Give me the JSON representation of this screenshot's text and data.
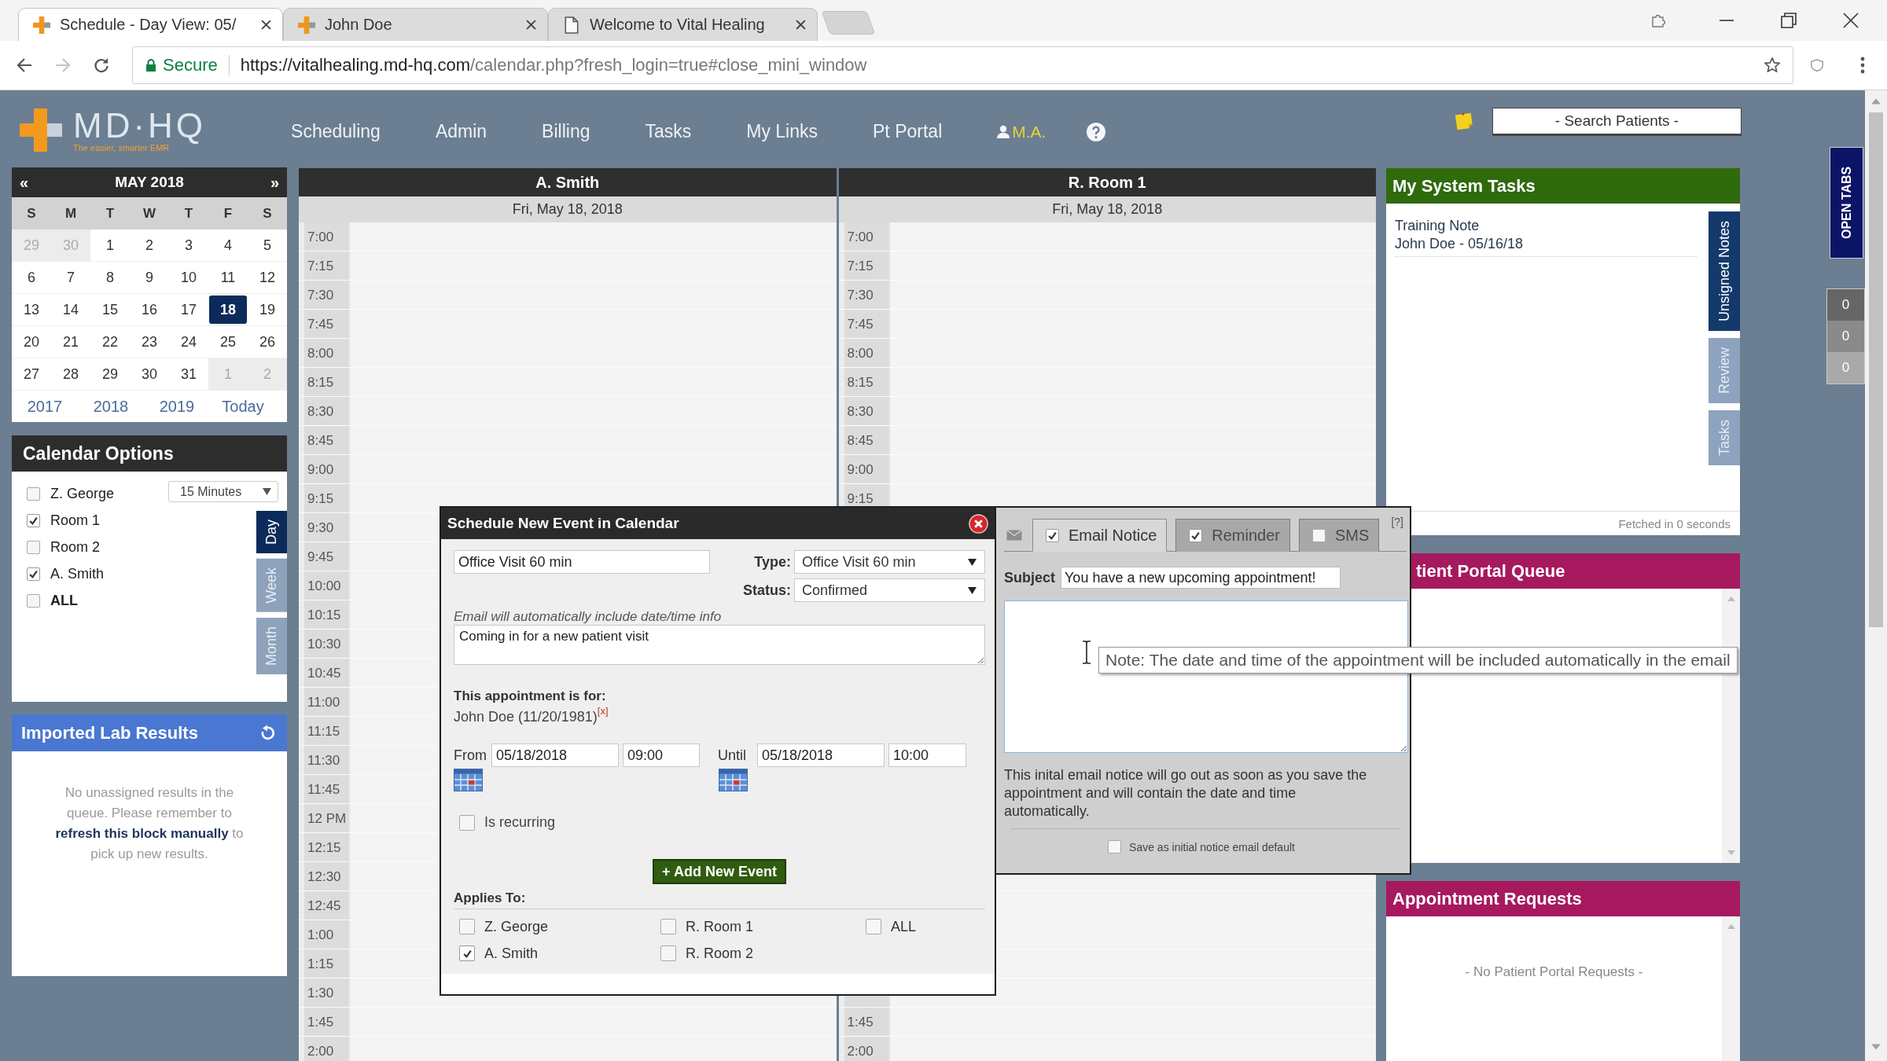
{
  "browser": {
    "tabs": [
      {
        "kind": "app",
        "title": "Schedule - Day View: 05/",
        "selected": true
      },
      {
        "kind": "app",
        "title": "John Doe",
        "selected": false
      },
      {
        "kind": "page",
        "title": "Welcome to Vital Healing",
        "selected": false
      }
    ],
    "secure_label": "Secure",
    "url_host": "https://vitalhealing.md-hq.com",
    "url_path": "/calendar.php?fresh_login=true#close_mini_window"
  },
  "header": {
    "logo": "MD·HQ",
    "tagline": "The easier, smarter EMR",
    "nav": [
      "Scheduling",
      "Admin",
      "Billing",
      "Tasks",
      "My Links",
      "Pt Portal"
    ],
    "user": "M.A.",
    "search_placeholder": "- Search Patients -"
  },
  "mini_calendar": {
    "prev": "«",
    "month": "MAY 2018",
    "next": "»",
    "weekdays": [
      "S",
      "M",
      "T",
      "W",
      "T",
      "F",
      "S"
    ],
    "weeks": [
      [
        {
          "day": "29",
          "other_month": true,
          "selected": false
        },
        {
          "day": "30",
          "other_month": true,
          "selected": false
        },
        {
          "day": "1",
          "other_month": false,
          "selected": false
        },
        {
          "day": "2",
          "other_month": false,
          "selected": false
        },
        {
          "day": "3",
          "other_month": false,
          "selected": false
        },
        {
          "day": "4",
          "other_month": false,
          "selected": false
        },
        {
          "day": "5",
          "other_month": false,
          "selected": false
        }
      ],
      [
        {
          "day": "6",
          "other_month": false,
          "selected": false
        },
        {
          "day": "7",
          "other_month": false,
          "selected": false
        },
        {
          "day": "8",
          "other_month": false,
          "selected": false
        },
        {
          "day": "9",
          "other_month": false,
          "selected": false
        },
        {
          "day": "10",
          "other_month": false,
          "selected": false
        },
        {
          "day": "11",
          "other_month": false,
          "selected": false
        },
        {
          "day": "12",
          "other_month": false,
          "selected": false
        }
      ],
      [
        {
          "day": "13",
          "other_month": false,
          "selected": false
        },
        {
          "day": "14",
          "other_month": false,
          "selected": false
        },
        {
          "day": "15",
          "other_month": false,
          "selected": false
        },
        {
          "day": "16",
          "other_month": false,
          "selected": false
        },
        {
          "day": "17",
          "other_month": false,
          "selected": false
        },
        {
          "day": "18",
          "other_month": false,
          "selected": true
        },
        {
          "day": "19",
          "other_month": false,
          "selected": false
        }
      ],
      [
        {
          "day": "20",
          "other_month": false,
          "selected": false
        },
        {
          "day": "21",
          "other_month": false,
          "selected": false
        },
        {
          "day": "22",
          "other_month": false,
          "selected": false
        },
        {
          "day": "23",
          "other_month": false,
          "selected": false
        },
        {
          "day": "24",
          "other_month": false,
          "selected": false
        },
        {
          "day": "25",
          "other_month": false,
          "selected": false
        },
        {
          "day": "26",
          "other_month": false,
          "selected": false
        }
      ],
      [
        {
          "day": "27",
          "other_month": false,
          "selected": false
        },
        {
          "day": "28",
          "other_month": false,
          "selected": false
        },
        {
          "day": "29",
          "other_month": false,
          "selected": false
        },
        {
          "day": "30",
          "other_month": false,
          "selected": false
        },
        {
          "day": "31",
          "other_month": false,
          "selected": false
        },
        {
          "day": "1",
          "other_month": true,
          "selected": false
        },
        {
          "day": "2",
          "other_month": true,
          "selected": false
        }
      ]
    ],
    "years": [
      "2017",
      "2018",
      "2019"
    ],
    "today": "Today"
  },
  "calendar_options": {
    "title": "Calendar Options",
    "resources": [
      {
        "kind": "resource",
        "label": "Z. George",
        "checked": false
      },
      {
        "kind": "resource",
        "label": "Room 1",
        "checked": true
      },
      {
        "kind": "resource",
        "label": "Room 2",
        "checked": false
      },
      {
        "kind": "resource",
        "label": "A. Smith",
        "checked": true
      },
      {
        "kind": "all",
        "label": "ALL",
        "checked": false
      }
    ],
    "interval": "15 Minutes",
    "views": [
      {
        "label": "Day",
        "selected": true
      },
      {
        "label": "Week",
        "selected": false
      },
      {
        "label": "Month",
        "selected": false
      }
    ]
  },
  "lab_results": {
    "title": "Imported Lab Results",
    "message_start": "No unassigned results in the queue. Please remember to",
    "refresh_link": "refresh this block manually",
    "message_end": "to pick up new results."
  },
  "calendar": {
    "columns": [
      {
        "name": "A. Smith",
        "date": "Fri, May 18, 2018",
        "times": [
          "7:00",
          "7:15",
          "7:30",
          "7:45",
          "8:00",
          "8:15",
          "8:30",
          "8:45",
          "9:00",
          "9:15",
          "9:30",
          "9:45",
          "10:00",
          "10:15",
          "10:30",
          "10:45",
          "11:00",
          "11:15",
          "11:30",
          "11:45",
          "12 PM",
          "12:15",
          "12:30",
          "12:45",
          "1:00",
          "1:15",
          "1:30",
          "1:45",
          "2:00"
        ]
      },
      {
        "name": "R. Room 1",
        "date": "Fri, May 18, 2018",
        "times": [
          "7:00",
          "7:15",
          "7:30",
          "7:45",
          "8:00",
          "8:15",
          "8:30",
          "8:45",
          "9:00",
          "9:15"
        ],
        "times_end": [
          "1:45",
          "2:00"
        ]
      }
    ]
  },
  "dialog": {
    "title": "Schedule New Event in Calendar",
    "name_value": "Office Visit 60 min",
    "type_label": "Type:",
    "type_value": "Office Visit 60 min",
    "status_label": "Status:",
    "status_value": "Confirmed",
    "email_hint": "Email will automatically include date/time info",
    "notes_value": "Coming in for a new patient visit",
    "for_label": "This appointment is for:",
    "patient": "John Doe (11/20/1981)",
    "remove_patient": "[x]",
    "from_label": "From",
    "from_date": "05/18/2018",
    "from_time": "09:00",
    "until_label": "Until",
    "until_date": "05/18/2018",
    "until_time": "10:00",
    "recurring": {
      "label": "Is recurring",
      "checked": false
    },
    "add_button": "+ Add New Event",
    "applies_label": "Applies To:",
    "applies": [
      {
        "label": "Z. George",
        "checked": false
      },
      {
        "label": "R. Room 1",
        "checked": false
      },
      {
        "label": "ALL",
        "checked": false
      },
      {
        "label": "A. Smith",
        "checked": true
      },
      {
        "label": "R. Room 2",
        "checked": false
      }
    ]
  },
  "email_panel": {
    "tabs": [
      {
        "label": "Email Notice",
        "checked": true,
        "selected": true
      },
      {
        "label": "Reminder",
        "checked": true,
        "selected": false
      },
      {
        "label": "SMS",
        "checked": false,
        "selected": false
      }
    ],
    "help": "[?]",
    "subject_label": "Subject",
    "subject_value": "You have a new upcoming appointment!",
    "note": "This inital email notice will go out as soon as you save the appointment and will contain the date and time automatically.",
    "save_default": {
      "label": "Save as initial notice email default",
      "checked": false
    }
  },
  "tooltip": "Note: The date and time of the appointment will be included automatically in the email",
  "system_tasks": {
    "title": "My System Tasks",
    "items": [
      {
        "title": "Training Note",
        "detail": "John Doe - 05/16/18"
      }
    ],
    "side_tabs": [
      {
        "label": "Unsigned Notes",
        "selected": true
      },
      {
        "label": "Review",
        "selected": false
      },
      {
        "label": "Tasks",
        "selected": false
      }
    ],
    "fetched": "Fetched in 0 seconds"
  },
  "patient_portal_queue": {
    "title": "tient Portal Queue"
  },
  "appointment_requests": {
    "title": "Appointment Requests",
    "empty_message": "- No Patient Portal Requests -"
  },
  "side_strip": {
    "open_tabs": "OPEN TABS",
    "counters": [
      "0",
      "0",
      "0"
    ]
  }
}
